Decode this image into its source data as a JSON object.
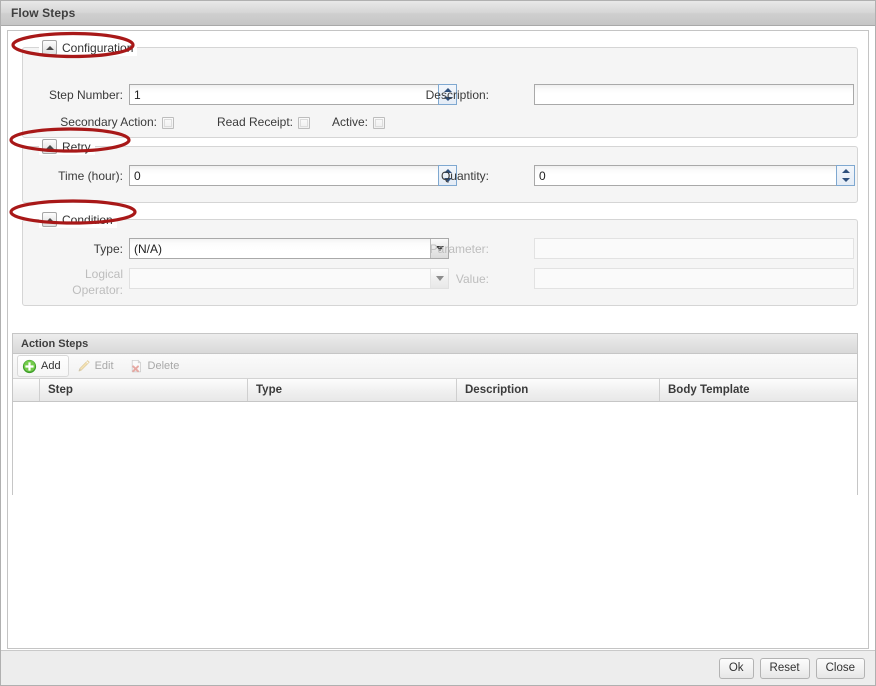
{
  "window": {
    "title": "Flow Steps"
  },
  "groups": {
    "configuration": {
      "legend": "Configuration",
      "toggle_icon": "caret-up-icon",
      "fields": {
        "step_number_label": "Step Number:",
        "step_number_value": "1",
        "description_label": "Description:",
        "description_value": "",
        "secondary_action_label": "Secondary Action:",
        "read_receipt_label": "Read Receipt:",
        "active_label": "Active:"
      }
    },
    "retry": {
      "legend": "Retry",
      "toggle_icon": "caret-up-icon",
      "fields": {
        "time_label": "Time (hour):",
        "time_value": "0",
        "quantity_label": "Quantity:",
        "quantity_value": "0"
      }
    },
    "condition": {
      "legend": "Condition",
      "toggle_icon": "caret-up-icon",
      "fields": {
        "type_label": "Type:",
        "type_value": "(N/A)",
        "logical_operator_label_line1": "Logical",
        "logical_operator_label_line2": "Operator:",
        "logical_operator_value": "",
        "parameter_label": "Parameter:",
        "parameter_value": "",
        "value_label": "Value:",
        "value_value": ""
      }
    }
  },
  "action_steps": {
    "panel_title": "Action Steps",
    "toolbar": [
      {
        "label": "Add",
        "icon": "plus-circle-icon",
        "enabled": true
      },
      {
        "label": "Edit",
        "icon": "pencil-icon",
        "enabled": false
      },
      {
        "label": "Delete",
        "icon": "delete-page-icon",
        "enabled": false
      }
    ],
    "columns": [
      "",
      "Step",
      "Type",
      "Description",
      "Body Template"
    ],
    "rows": []
  },
  "footer": {
    "buttons": [
      "Ok",
      "Reset",
      "Close"
    ]
  },
  "annotations": {
    "color": "#a81818",
    "marks": [
      "ellipse-configuration",
      "ellipse-retry",
      "ellipse-condition"
    ]
  }
}
